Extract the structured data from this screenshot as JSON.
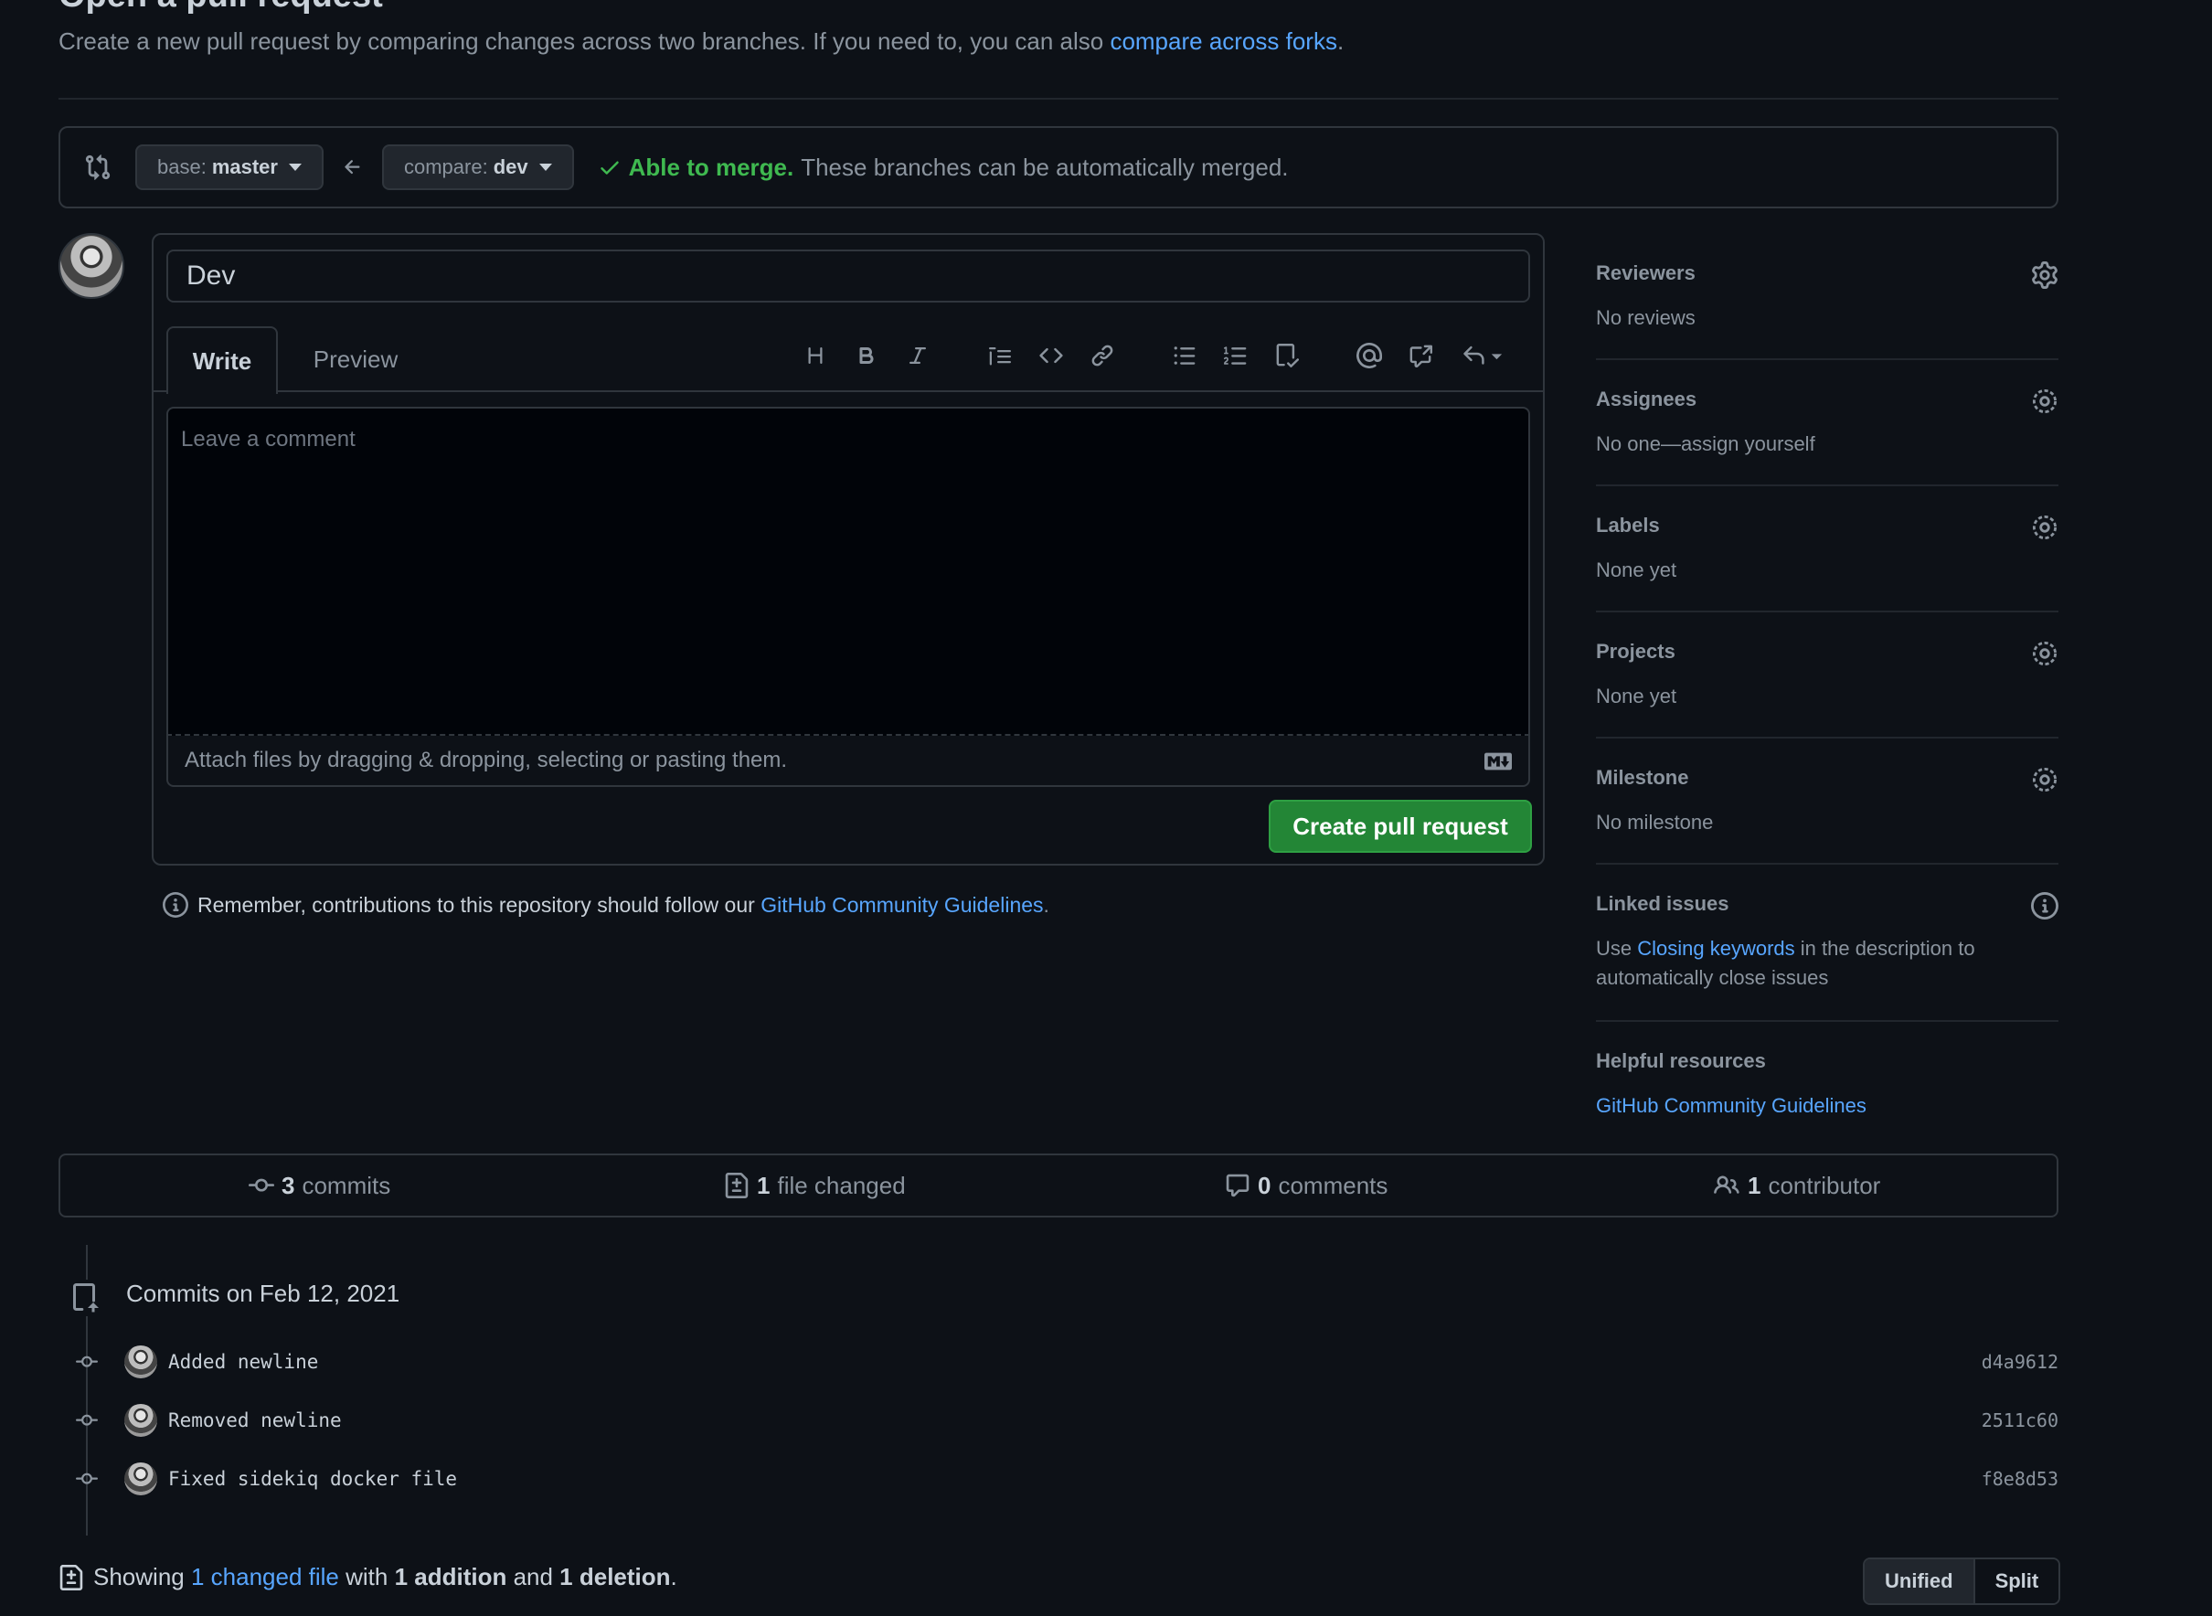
{
  "header": {
    "title": "Open a pull request",
    "subtitle": "Create a new pull request by comparing changes across two branches. If you need to, you can also ",
    "subtitle_link": "compare across forks",
    "subtitle_end": "."
  },
  "range": {
    "base_prefix": "base:",
    "base_branch": "master",
    "compare_prefix": "compare:",
    "compare_branch": "dev",
    "merge_status": "Able to merge.",
    "merge_detail": "These branches can be automatically merged.",
    "merge_color": "#3fb950"
  },
  "form": {
    "title_value": "Dev",
    "tab_write": "Write",
    "tab_preview": "Preview",
    "comment_placeholder": "Leave a comment",
    "attach_text": "Attach files by dragging & dropping, selecting or pasting them.",
    "submit_label": "Create pull request"
  },
  "remember": {
    "text": "Remember, contributions to this repository should follow our ",
    "link": "GitHub Community Guidelines",
    "end": "."
  },
  "sidebar": {
    "reviewers": {
      "label": "Reviewers",
      "value": "No reviews"
    },
    "assignees": {
      "label": "Assignees",
      "value": "No one—assign yourself"
    },
    "labels": {
      "label": "Labels",
      "value": "None yet"
    },
    "projects": {
      "label": "Projects",
      "value": "None yet"
    },
    "milestone": {
      "label": "Milestone",
      "value": "No milestone"
    },
    "linked": {
      "label": "Linked issues",
      "pre": "Use ",
      "link": "Closing keywords",
      "post": " in the description to automatically close issues"
    },
    "helpful": {
      "label": "Helpful resources",
      "link": "GitHub Community Guidelines"
    }
  },
  "stats": {
    "commits_count": "3",
    "commits_label": "commits",
    "files_count": "1",
    "files_label": "file changed",
    "comments_count": "0",
    "comments_label": "comments",
    "contributors_count": "1",
    "contributors_label": "contributor"
  },
  "commits": {
    "group_title": "Commits on Feb 12, 2021",
    "items": [
      {
        "message": "Added newline",
        "sha": "d4a9612"
      },
      {
        "message": "Removed newline",
        "sha": "2511c60"
      },
      {
        "message": "Fixed sidekiq docker file",
        "sha": "f8e8d53"
      }
    ]
  },
  "summary": {
    "pre": "Showing ",
    "link": "1 changed file",
    "mid": " with ",
    "additions": "1 addition",
    "and": " and ",
    "deletions": "1 deletion",
    "end": ".",
    "unified_label": "Unified",
    "split_label": "Split"
  }
}
